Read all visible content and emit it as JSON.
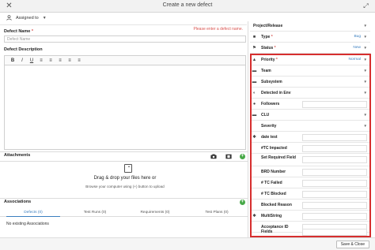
{
  "window": {
    "title": "Create a new defect"
  },
  "assign": {
    "label": "Assigned to"
  },
  "left": {
    "defect_name_label": "Defect Name",
    "defect_name_error": "Please enter a defect name.",
    "defect_name_placeholder": "Defect Name",
    "description_label": "Defect Description",
    "toolbar": [
      "B",
      "I",
      "U",
      "≡",
      "≡",
      "≡",
      "≡",
      "≡"
    ],
    "attachments_label": "Attachments",
    "drop_title": "Drag & drop your files here or",
    "drop_sub": "Browse your computer using (+) button to upload",
    "associations_label": "Associations",
    "tabs": [
      "Defects (0)",
      "Test Runs (0)",
      "Requirements (0)",
      "Test Plans (0)"
    ],
    "no_assoc": "No existing Associations"
  },
  "right": {
    "rows": [
      {
        "label": "Project/Release",
        "value": "",
        "icon": "none"
      },
      {
        "label": "Type",
        "value": "Bug",
        "icon": "bookmark-icon"
      },
      {
        "label": "Status",
        "value": "New",
        "icon": "flag-icon"
      },
      {
        "label": "Priority",
        "value": "Normal",
        "icon": "warning-icon"
      },
      {
        "label": "Team",
        "value": "",
        "icon": "users-icon"
      },
      {
        "label": "Subsystem",
        "value": "",
        "icon": "folder-icon"
      },
      {
        "label": "Detected in Env",
        "value": "",
        "icon": "half-circle-icon"
      },
      {
        "label": "Followers",
        "value": "",
        "icon": "people-icon"
      },
      {
        "label": "CLU",
        "value": "",
        "icon": "folder-icon"
      },
      {
        "label": "Severity",
        "value": "",
        "icon": "none"
      },
      {
        "label": "date test",
        "value": "",
        "icon": "gear-icon"
      },
      {
        "label": "#TC Impacted",
        "value": "",
        "icon": "none"
      },
      {
        "label": "Set Required Field",
        "value": "",
        "icon": "none"
      },
      {
        "label": "BRD Number",
        "value": "",
        "icon": "none"
      },
      {
        "label": "# TC Failed",
        "value": "",
        "icon": "none"
      },
      {
        "label": "# TC Blocked",
        "value": "",
        "icon": "none"
      },
      {
        "label": "Blocked Reason",
        "value": "",
        "icon": "none"
      },
      {
        "label": "MultiString",
        "value": "",
        "icon": "gear-icon"
      },
      {
        "label": "Acceptance ID",
        "value": "",
        "icon": "none"
      },
      {
        "label": "Fields",
        "value": "",
        "icon": "none"
      }
    ]
  },
  "footer": {
    "save_close": "Save & Close"
  }
}
